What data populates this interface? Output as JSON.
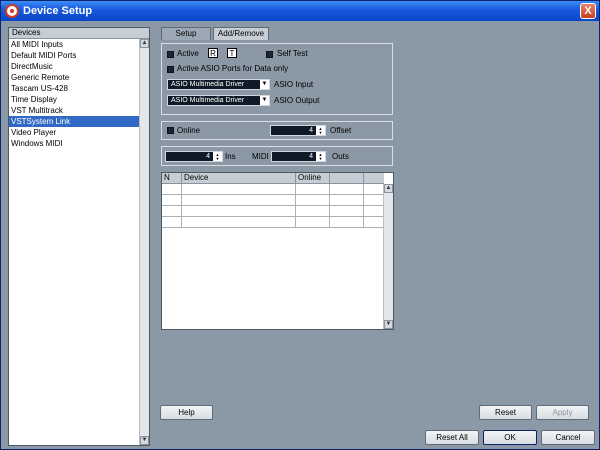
{
  "window": {
    "title": "Device Setup",
    "close_label": "X"
  },
  "sidebar": {
    "header": "Devices",
    "items": [
      {
        "label": "All MIDI Inputs"
      },
      {
        "label": "Default MIDI Ports"
      },
      {
        "label": "DirectMusic"
      },
      {
        "label": "Generic Remote"
      },
      {
        "label": "Tascam US-428"
      },
      {
        "label": "Time Display"
      },
      {
        "label": "VST Multitrack"
      },
      {
        "label": "VSTSystem Link",
        "selected": true
      },
      {
        "label": "Video Player"
      },
      {
        "label": "Windows MIDI"
      }
    ]
  },
  "tabs": [
    {
      "label": "Setup",
      "active": true
    },
    {
      "label": "Add/Remove"
    }
  ],
  "setup": {
    "active_label": "Active",
    "r_label": "R",
    "t_label": "T",
    "self_test_label": "Self Test",
    "asio_ports_label": "Active ASIO Ports for  Data only",
    "asio_input_value": "ASIO Multimedia Driver",
    "asio_input_label": "ASIO Input",
    "asio_output_value": "ASIO Multimedia Driver",
    "asio_output_label": "ASIO Output",
    "online_label": "Online",
    "offset_value": "4",
    "offset_label": "Offset",
    "ins_value": "4",
    "ins_label": "Ins",
    "midi_label": "MIDI",
    "outs_value": "4",
    "outs_label": "Outs"
  },
  "table": {
    "columns": [
      "N",
      "Device",
      "Online",
      ""
    ]
  },
  "buttons": {
    "help": "Help",
    "reset": "Reset",
    "apply": "Apply",
    "reset_all": "Reset All",
    "ok": "OK",
    "cancel": "Cancel"
  },
  "icons": {
    "scroll_up": "▲",
    "scroll_down": "▼",
    "dropdown": "▼",
    "spin_up": "▲",
    "spin_down": "▼"
  }
}
